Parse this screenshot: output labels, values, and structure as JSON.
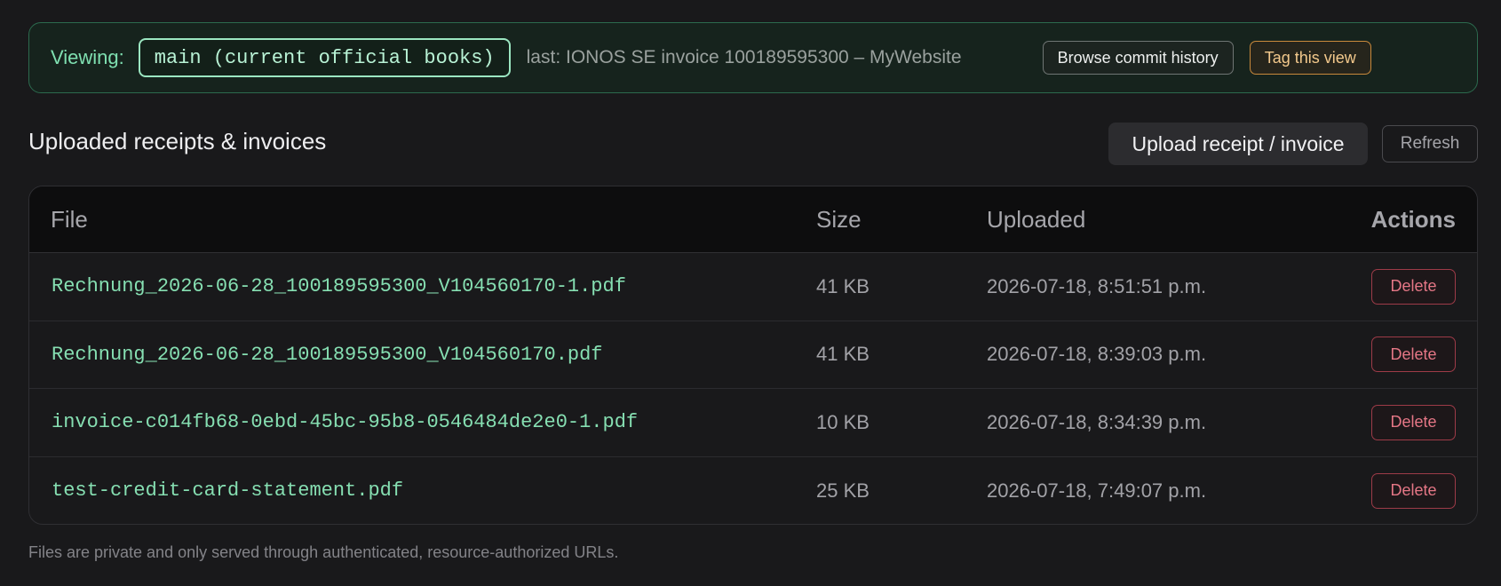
{
  "banner": {
    "viewing_label": "Viewing:",
    "branch": "main (current official books)",
    "last_commit": "last: IONOS SE invoice 100189595300 – MyWebsite",
    "browse_label": "Browse commit history",
    "tag_label": "Tag this view"
  },
  "section": {
    "title": "Uploaded receipts & invoices",
    "upload_label": "Upload receipt / invoice",
    "refresh_label": "Refresh"
  },
  "table": {
    "headers": {
      "file": "File",
      "size": "Size",
      "uploaded": "Uploaded",
      "actions": "Actions"
    },
    "rows": [
      {
        "file": "Rechnung_2026-06-28_100189595300_V104560170-1.pdf",
        "size": "41 KB",
        "uploaded": "2026-07-18, 8:51:51 p.m.",
        "action": "Delete"
      },
      {
        "file": "Rechnung_2026-06-28_100189595300_V104560170.pdf",
        "size": "41 KB",
        "uploaded": "2026-07-18, 8:39:03 p.m.",
        "action": "Delete"
      },
      {
        "file": "invoice-c014fb68-0ebd-45bc-95b8-0546484de2e0-1.pdf",
        "size": "10 KB",
        "uploaded": "2026-07-18, 8:34:39 p.m.",
        "action": "Delete"
      },
      {
        "file": "test-credit-card-statement.pdf",
        "size": "25 KB",
        "uploaded": "2026-07-18, 7:49:07 p.m.",
        "action": "Delete"
      }
    ]
  },
  "footnote": "Files are private and only served through authenticated, resource-authorized URLs.",
  "colors": {
    "accent_green": "#86dfb2",
    "tag_orange": "#c8893c",
    "delete_red": "#e57786"
  }
}
